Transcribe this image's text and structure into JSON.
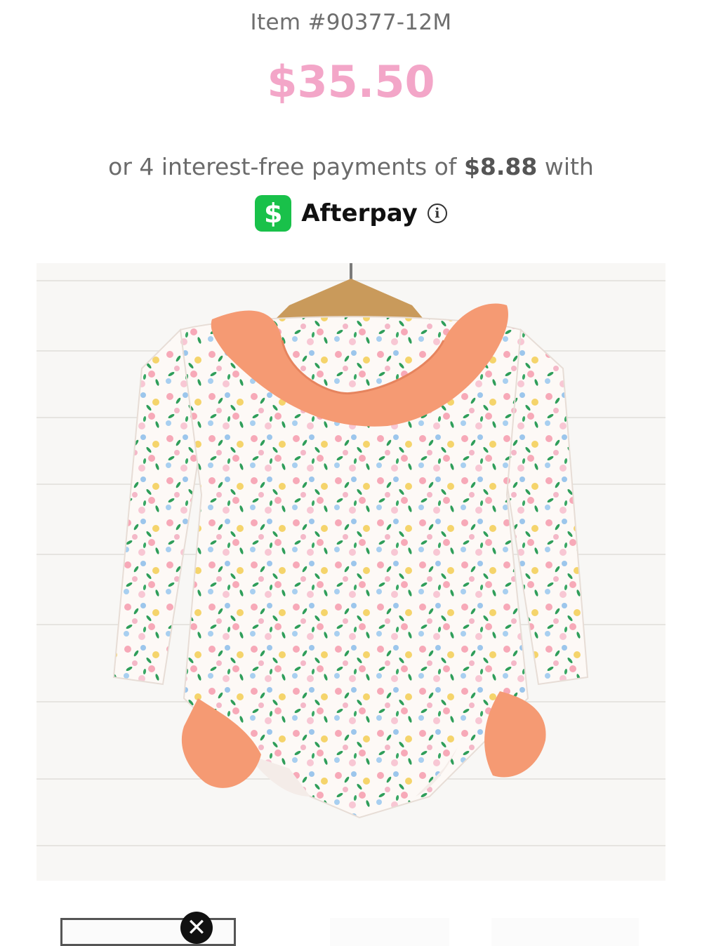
{
  "product": {
    "item_number": "Item #90377-12M",
    "price": "$35.50"
  },
  "installments": {
    "prefix": "or 4 interest-free payments of",
    "amount": "$8.88",
    "suffix": "with"
  },
  "afterpay": {
    "badge_symbol": "$",
    "name": "Afterpay",
    "info_symbol": "i"
  },
  "thumbnails": {
    "close_symbol": "✕"
  },
  "colors": {
    "price_pink": "#f3a6c8",
    "afterpay_green": "#19c14a",
    "ruffle_coral": "#f59a73"
  }
}
